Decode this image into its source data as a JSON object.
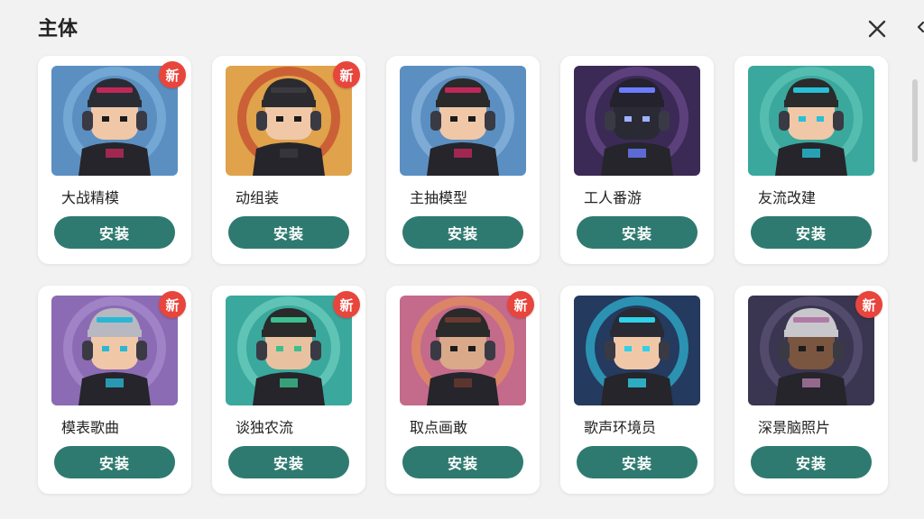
{
  "header": {
    "title": "主体",
    "close_icon": "close-icon"
  },
  "items": [
    {
      "name": "大战精模",
      "button": "安装",
      "badge": "新",
      "bg": "#5b8fc2",
      "ring": "#7db0db",
      "helmet": "#2a2c34",
      "visor": "#c0285a",
      "eye": "#1b1b1b",
      "skin": "#f0c8a8"
    },
    {
      "name": "动组装",
      "button": "安装",
      "badge": "新",
      "bg": "#e0a24a",
      "ring": "#c2452d",
      "helmet": "#2b2b2f",
      "visor": "#3a3a40",
      "eye": "#1b1b1b",
      "skin": "#f0c8a8"
    },
    {
      "name": "主抽模型",
      "button": "安装",
      "badge": "",
      "bg": "#5b8fc2",
      "ring": "#8cb7de",
      "helmet": "#2a2a2a",
      "visor": "#c0285a",
      "eye": "#1b1b1b",
      "skin": "#f0c8a8"
    },
    {
      "name": "工人番游",
      "button": "安装",
      "badge": "",
      "bg": "#3b2a55",
      "ring": "#6b4a8c",
      "helmet": "#24222d",
      "visor": "#6c7cff",
      "eye": "#9fb2ff",
      "skin": "#2a2a34"
    },
    {
      "name": "友流改建",
      "button": "安装",
      "badge": "",
      "bg": "#3aa89c",
      "ring": "#5fc6b8",
      "helmet": "#2b2b2b",
      "visor": "#27c0d6",
      "eye": "#27c0d6",
      "skin": "#f0c8a8"
    },
    {
      "name": "模表歌曲",
      "button": "安装",
      "badge": "新",
      "bg": "#8b6bb3",
      "ring": "#a98bcf",
      "helmet": "#b8b8c2",
      "visor": "#2ab7d4",
      "eye": "#2ab7d4",
      "skin": "#f0c8a8"
    },
    {
      "name": "谈独农流",
      "button": "安装",
      "badge": "新",
      "bg": "#3aa89c",
      "ring": "#6fd0c2",
      "helmet": "#2a2a2a",
      "visor": "#3cbf8f",
      "eye": "#3cbf8f",
      "skin": "#e8c2a0"
    },
    {
      "name": "取点画敢",
      "button": "安装",
      "badge": "新",
      "bg": "#c46a8a",
      "ring": "#e6905a",
      "helmet": "#2a2a2a",
      "visor": "#6a3a30",
      "eye": "#1b1b1b",
      "skin": "#d9a98a"
    },
    {
      "name": "歌声环境员",
      "button": "安装",
      "badge": "",
      "bg": "#243a5e",
      "ring": "#2fb8d6",
      "helmet": "#2a2a34",
      "visor": "#2fd0e8",
      "eye": "#2fd0e8",
      "skin": "#f0c8a8"
    },
    {
      "name": "深景脑照片",
      "button": "安装",
      "badge": "新",
      "bg": "#3a3550",
      "ring": "#5c5678",
      "helmet": "#c8c8cc",
      "visor": "#b07aa8",
      "eye": "#1b1b1b",
      "skin": "#7a5540"
    }
  ]
}
